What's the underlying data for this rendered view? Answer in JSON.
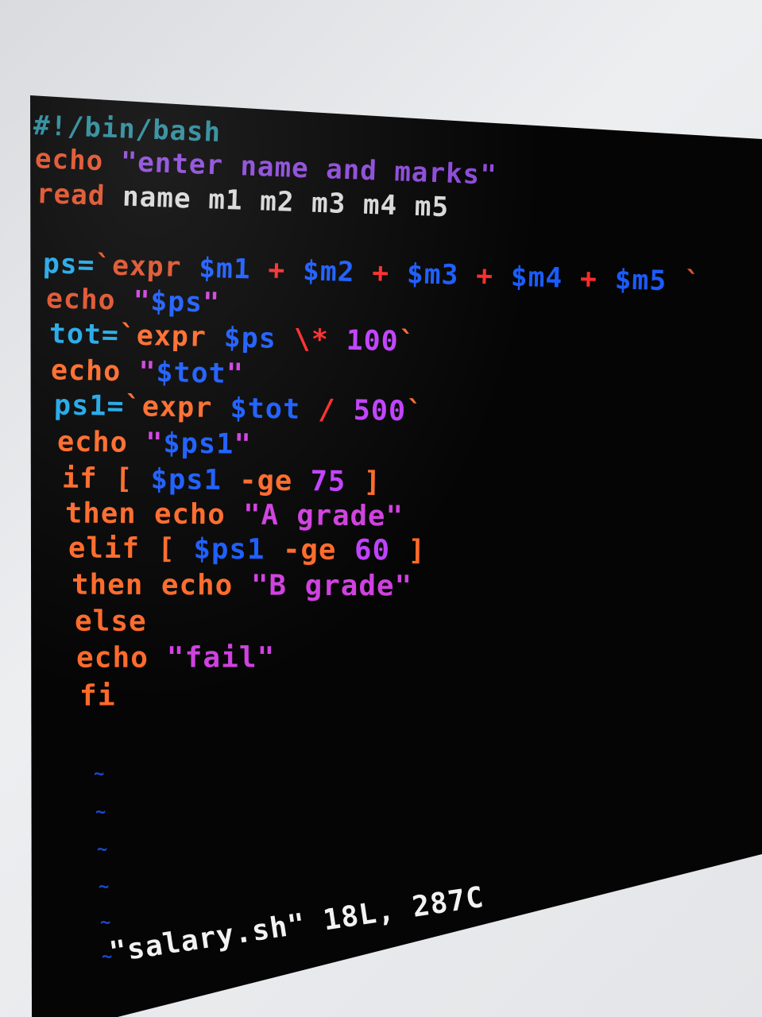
{
  "editor": {
    "lines": [
      {
        "segments": [
          {
            "t": "#!/bin/bash",
            "c": "c-comment"
          }
        ]
      },
      {
        "segments": [
          {
            "t": "echo ",
            "c": "c-kw2"
          },
          {
            "t": "\"enter name and marks\"",
            "c": "c-str-dim"
          }
        ]
      },
      {
        "segments": [
          {
            "t": "read ",
            "c": "c-kw2"
          },
          {
            "t": "name m1 m2 m3 m4 m5",
            "c": "c-plain"
          }
        ]
      },
      {
        "segments": []
      },
      {
        "segments": [
          {
            "t": "ps=",
            "c": "c-var-cyan"
          },
          {
            "t": "`expr ",
            "c": "c-kw2"
          },
          {
            "t": "$m1",
            "c": "c-var"
          },
          {
            "t": " + ",
            "c": "c-op"
          },
          {
            "t": "$m2",
            "c": "c-var"
          },
          {
            "t": " + ",
            "c": "c-op"
          },
          {
            "t": "$m3",
            "c": "c-var"
          },
          {
            "t": " + ",
            "c": "c-op"
          },
          {
            "t": "$m4",
            "c": "c-var"
          },
          {
            "t": " + ",
            "c": "c-op"
          },
          {
            "t": "$m5",
            "c": "c-var"
          },
          {
            "t": " `",
            "c": "c-kw2"
          }
        ]
      },
      {
        "segments": [
          {
            "t": "echo ",
            "c": "c-kw2"
          },
          {
            "t": "\"",
            "c": "c-str"
          },
          {
            "t": "$ps",
            "c": "c-var"
          },
          {
            "t": "\"",
            "c": "c-str"
          }
        ]
      },
      {
        "segments": [
          {
            "t": "tot=",
            "c": "c-var-cyan"
          },
          {
            "t": "`expr ",
            "c": "c-kw"
          },
          {
            "t": "$ps",
            "c": "c-var"
          },
          {
            "t": " \\* ",
            "c": "c-op"
          },
          {
            "t": "100",
            "c": "c-num"
          },
          {
            "t": "`",
            "c": "c-kw"
          }
        ]
      },
      {
        "segments": [
          {
            "t": "echo ",
            "c": "c-kw"
          },
          {
            "t": "\"",
            "c": "c-str"
          },
          {
            "t": "$tot",
            "c": "c-var"
          },
          {
            "t": "\"",
            "c": "c-str"
          }
        ]
      },
      {
        "segments": [
          {
            "t": "ps1=",
            "c": "c-var-cyan"
          },
          {
            "t": "`expr ",
            "c": "c-kw"
          },
          {
            "t": "$tot",
            "c": "c-var"
          },
          {
            "t": " / ",
            "c": "c-op"
          },
          {
            "t": "500",
            "c": "c-num"
          },
          {
            "t": "`",
            "c": "c-kw"
          }
        ]
      },
      {
        "segments": [
          {
            "t": "echo ",
            "c": "c-kw"
          },
          {
            "t": "\"",
            "c": "c-str"
          },
          {
            "t": "$ps1",
            "c": "c-var"
          },
          {
            "t": "\"",
            "c": "c-str"
          }
        ]
      },
      {
        "segments": [
          {
            "t": "if [ ",
            "c": "c-kw"
          },
          {
            "t": "$ps1",
            "c": "c-var"
          },
          {
            "t": " -ge ",
            "c": "c-kw"
          },
          {
            "t": "75",
            "c": "c-num"
          },
          {
            "t": " ]",
            "c": "c-kw"
          }
        ]
      },
      {
        "segments": [
          {
            "t": "then echo ",
            "c": "c-kw"
          },
          {
            "t": "\"A grade\"",
            "c": "c-str"
          }
        ]
      },
      {
        "segments": [
          {
            "t": "elif [ ",
            "c": "c-kw"
          },
          {
            "t": "$ps1",
            "c": "c-var"
          },
          {
            "t": " -ge ",
            "c": "c-kw"
          },
          {
            "t": "60",
            "c": "c-num"
          },
          {
            "t": " ]",
            "c": "c-kw"
          }
        ]
      },
      {
        "segments": [
          {
            "t": "then echo ",
            "c": "c-kw"
          },
          {
            "t": "\"B grade\"",
            "c": "c-str"
          }
        ]
      },
      {
        "segments": [
          {
            "t": "else",
            "c": "c-kw"
          }
        ]
      },
      {
        "segments": [
          {
            "t": "echo ",
            "c": "c-kw"
          },
          {
            "t": "\"fail\"",
            "c": "c-str"
          }
        ]
      },
      {
        "segments": [
          {
            "t": "fi",
            "c": "c-kw"
          }
        ]
      }
    ],
    "tilde": "~",
    "status": "\"salary.sh\" 18L, 287C"
  }
}
